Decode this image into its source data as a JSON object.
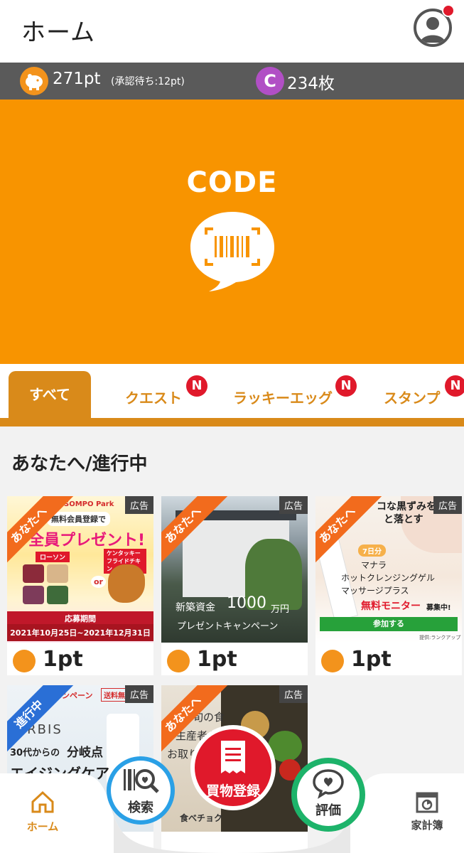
{
  "header": {
    "title": "ホーム"
  },
  "points": {
    "value": "271pt",
    "pending": "(承認待ち:12pt)",
    "coin_letter": "C",
    "coins": "234枚"
  },
  "banner": {
    "label": "CODE"
  },
  "tabs": [
    {
      "label": "すべて",
      "active": true
    },
    {
      "label": "クエスト",
      "badge": "N"
    },
    {
      "label": "ラッキーエッグ",
      "badge": "N"
    },
    {
      "label": "スタンプ",
      "badge": "N"
    }
  ],
  "section": {
    "title": "あなたへ/進行中"
  },
  "cards": [
    {
      "ad": "広告",
      "ribbon": "あなたへ",
      "reward": "1pt",
      "lines": [
        "SOMPO Park",
        "無料会員登録で",
        "全員プレゼント!",
        "ローソン",
        "ケンタッキー フライドチキン",
        "or",
        "応募期間",
        "2021年10月25日~2021年12月31日"
      ]
    },
    {
      "ad": "広告",
      "ribbon": "あなたへ",
      "reward": "1pt",
      "lines": [
        "新築資金",
        "1000",
        "万円",
        "プレゼントキャンペーン"
      ]
    },
    {
      "ad": "広告",
      "ribbon": "あなたへ",
      "reward": "1pt",
      "lines": [
        "コな黒ずみを",
        "と落とす",
        "7日分",
        "マナラ",
        "ホットクレンジングゲル",
        "マッサージプラス",
        "無料モニター",
        "募集中!",
        "参加する",
        "提供:ランクアップ"
      ]
    },
    {
      "ad": "広告",
      "ribbon": "進行中",
      "lines": [
        "ャンペーン",
        "送料無",
        "ORBIS",
        "30代からの",
        "分岐点",
        "エイジングケア"
      ]
    },
    {
      "ad": "広告",
      "ribbon": "あなたへ",
      "lines": [
        "旬の食",
        "生産者から",
        "お取り寄せ。",
        "食べチョク"
      ]
    }
  ],
  "bottom_nav": {
    "home": "ホーム",
    "search": "検索",
    "register": "買物登録",
    "rate": "評価",
    "book": "家計簿"
  },
  "colors": {
    "brand_orange": "#f89400",
    "tab_orange": "#d98a1a",
    "badge_red": "#e0192b",
    "coin_purple": "#b14fc5",
    "search_blue": "#2aa0e6",
    "rate_green": "#1db36a"
  }
}
